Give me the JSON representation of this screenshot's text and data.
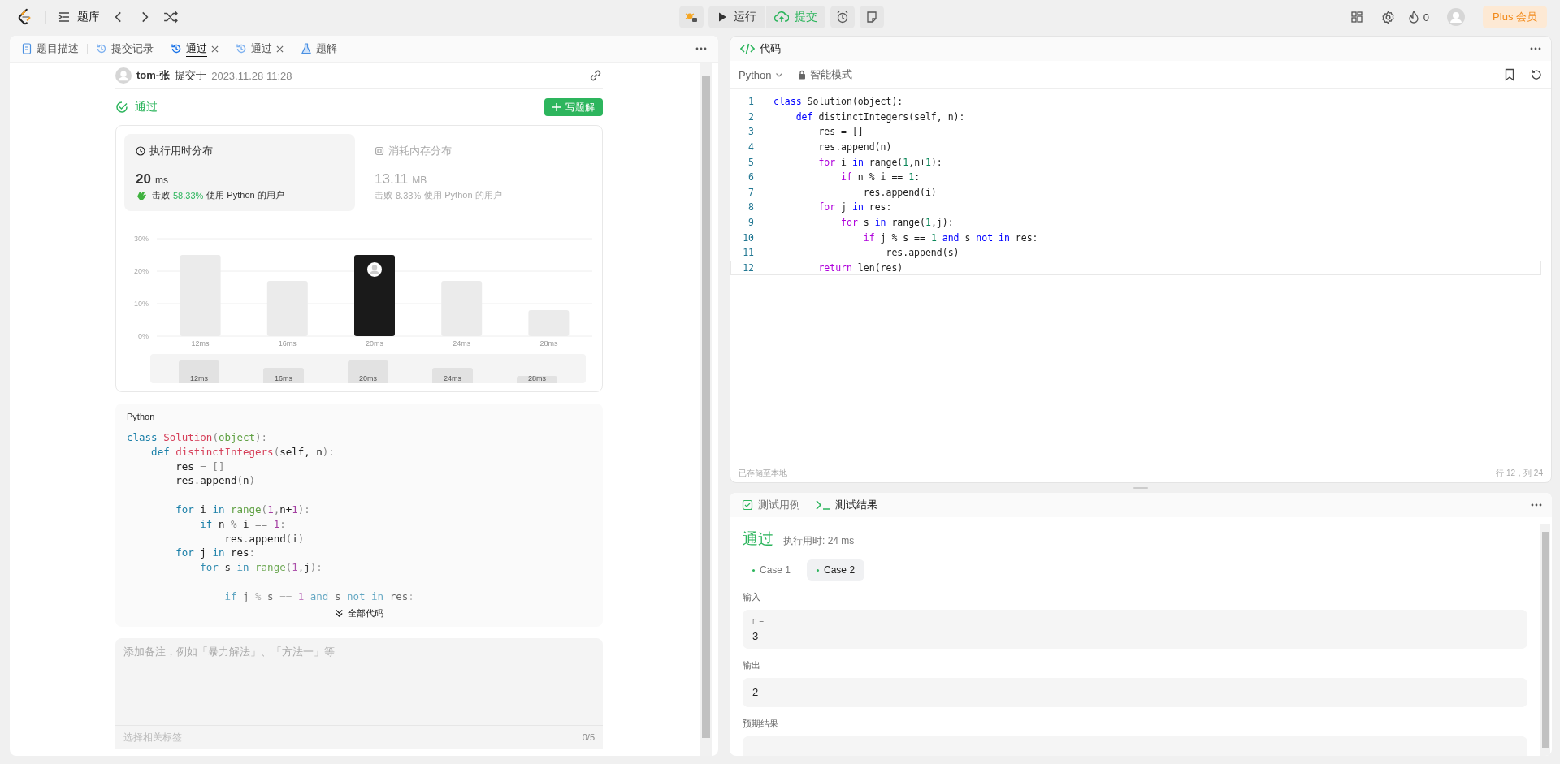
{
  "topbar": {
    "problem_list": "题库",
    "run": "运行",
    "submit": "提交",
    "streak": "0",
    "plus": "Plus 会员"
  },
  "left_tabs": [
    {
      "label": "题目描述",
      "kind": "doc",
      "selected": false,
      "closable": false
    },
    {
      "label": "提交记录",
      "kind": "history",
      "selected": false,
      "closable": false
    },
    {
      "label": "通过",
      "kind": "history",
      "selected": true,
      "closable": true
    },
    {
      "label": "通过",
      "kind": "history",
      "selected": false,
      "closable": true
    },
    {
      "label": "题解",
      "kind": "flask",
      "selected": false,
      "closable": false
    }
  ],
  "submission": {
    "user": "tom-张",
    "submitted": "提交于",
    "time": "2023.11.28 11:28",
    "status": "通过",
    "write_solution": "写题解"
  },
  "stats": {
    "tiles": [
      {
        "kind": "time",
        "title": "执行用时分布",
        "value": "20",
        "unit": "ms",
        "beat": "击败",
        "percent": "58.33%",
        "suffix": "使用 Python 的用户",
        "selected": true
      },
      {
        "kind": "memory",
        "title": "消耗内存分布",
        "value": "13.11",
        "unit": "MB",
        "beat": "击败",
        "percent": "8.33%",
        "suffix": "使用 Python 的用户",
        "selected": false
      }
    ],
    "chart_data": {
      "type": "bar",
      "categories": [
        "12ms",
        "16ms",
        "20ms",
        "24ms",
        "28ms"
      ],
      "values": [
        25,
        17,
        25,
        17,
        8
      ],
      "ylim": [
        0,
        30
      ],
      "yticks": [
        {
          "value": 0,
          "label": "0%"
        },
        {
          "value": 10,
          "label": "10%"
        },
        {
          "value": 20,
          "label": "20%"
        },
        {
          "value": 30,
          "label": "30%"
        }
      ]
    },
    "bars": [
      {
        "selected": false
      },
      {
        "selected": false
      },
      {
        "selected": true
      },
      {
        "selected": false
      },
      {
        "selected": false
      }
    ],
    "overview_labels": [
      "12ms",
      "16ms",
      "20ms",
      "24ms",
      "28ms"
    ]
  },
  "solution_code": {
    "language": "Python",
    "expand": "全部代码",
    "lines": [
      {
        "kind": "code",
        "tokens": [
          {
            "kind": "kw",
            "text": "class"
          },
          {
            "kind": "name",
            "text": " Solution"
          },
          {
            "kind": "pu",
            "text": "("
          },
          {
            "kind": "bi",
            "text": "object"
          },
          {
            "kind": "pu",
            "text": "):"
          }
        ]
      },
      {
        "kind": "code",
        "tokens": [
          {
            "kind": "kw",
            "text": "    def"
          },
          {
            "kind": "name",
            "text": " distinctIntegers"
          },
          {
            "kind": "pu",
            "text": "("
          },
          {
            "kind": "p",
            "text": "self, n"
          },
          {
            "kind": "pu",
            "text": "):"
          }
        ]
      },
      {
        "kind": "code",
        "tokens": [
          {
            "kind": "p",
            "text": "        res "
          },
          {
            "kind": "pu",
            "text": "= []"
          }
        ]
      },
      {
        "kind": "code",
        "tokens": [
          {
            "kind": "p",
            "text": "        res"
          },
          {
            "kind": "pu",
            "text": "."
          },
          {
            "kind": "p",
            "text": "append"
          },
          {
            "kind": "pu",
            "text": "("
          },
          {
            "kind": "p",
            "text": "n"
          },
          {
            "kind": "pu",
            "text": ")"
          }
        ]
      },
      {
        "kind": "blank"
      },
      {
        "kind": "code",
        "tokens": [
          {
            "kind": "ctrl",
            "text": "        for"
          },
          {
            "kind": "p",
            "text": " i "
          },
          {
            "kind": "ctrl",
            "text": "in"
          },
          {
            "kind": "bi",
            "text": " range"
          },
          {
            "kind": "pu",
            "text": "("
          },
          {
            "kind": "num",
            "text": "1"
          },
          {
            "kind": "pu",
            "text": ","
          },
          {
            "kind": "p",
            "text": "n+"
          },
          {
            "kind": "num",
            "text": "1"
          },
          {
            "kind": "pu",
            "text": "):"
          }
        ]
      },
      {
        "kind": "code",
        "tokens": [
          {
            "kind": "ctrl",
            "text": "            if"
          },
          {
            "kind": "p",
            "text": " n "
          },
          {
            "kind": "pu",
            "text": "%"
          },
          {
            "kind": "p",
            "text": " i "
          },
          {
            "kind": "pu",
            "text": "=="
          },
          {
            "kind": "num",
            "text": " 1"
          },
          {
            "kind": "pu",
            "text": ":"
          }
        ]
      },
      {
        "kind": "code",
        "tokens": [
          {
            "kind": "p",
            "text": "                res"
          },
          {
            "kind": "pu",
            "text": "."
          },
          {
            "kind": "p",
            "text": "append"
          },
          {
            "kind": "pu",
            "text": "("
          },
          {
            "kind": "p",
            "text": "i"
          },
          {
            "kind": "pu",
            "text": ")"
          }
        ]
      },
      {
        "kind": "code",
        "tokens": [
          {
            "kind": "ctrl",
            "text": "        for"
          },
          {
            "kind": "p",
            "text": " j "
          },
          {
            "kind": "ctrl",
            "text": "in"
          },
          {
            "kind": "p",
            "text": " res"
          },
          {
            "kind": "pu",
            "text": ":"
          }
        ]
      },
      {
        "kind": "code",
        "tokens": [
          {
            "kind": "ctrl",
            "text": "            for"
          },
          {
            "kind": "p",
            "text": " s "
          },
          {
            "kind": "ctrl",
            "text": "in"
          },
          {
            "kind": "bi",
            "text": " range"
          },
          {
            "kind": "pu",
            "text": "("
          },
          {
            "kind": "num",
            "text": "1"
          },
          {
            "kind": "pu",
            "text": ","
          },
          {
            "kind": "p",
            "text": "j"
          },
          {
            "kind": "pu",
            "text": "):"
          }
        ]
      },
      {
        "kind": "blank"
      },
      {
        "kind": "code",
        "tokens": [
          {
            "kind": "ctrl",
            "text": "                if"
          },
          {
            "kind": "p",
            "text": " j "
          },
          {
            "kind": "pu",
            "text": "%"
          },
          {
            "kind": "p",
            "text": " s "
          },
          {
            "kind": "pu",
            "text": "=="
          },
          {
            "kind": "num",
            "text": " 1"
          },
          {
            "kind": "ctrl",
            "text": " and"
          },
          {
            "kind": "p",
            "text": " s "
          },
          {
            "kind": "ctrl",
            "text": "not"
          },
          {
            "kind": "ctrl",
            "text": " in"
          },
          {
            "kind": "p",
            "text": " res"
          },
          {
            "kind": "pu",
            "text": ":"
          }
        ]
      }
    ]
  },
  "note": {
    "placeholder": "添加备注，例如「暴力解法」、「方法一」等",
    "tags": "选择相关标签",
    "count": "0/5"
  },
  "editor": {
    "title": "代码",
    "language": "Python",
    "mode": "智能模式",
    "saved": "已存储至本地",
    "cursor": "行 12，列 24",
    "lines": [
      {
        "number": "1",
        "current": false,
        "tokens": [
          {
            "kind": "kw",
            "text": "class"
          },
          {
            "kind": "p",
            "text": " Solution(object):"
          }
        ]
      },
      {
        "number": "2",
        "current": false,
        "tokens": [
          {
            "kind": "kw",
            "text": "    def"
          },
          {
            "kind": "p",
            "text": " distinctIntegers(self, n):"
          }
        ]
      },
      {
        "number": "3",
        "current": false,
        "tokens": [
          {
            "kind": "p",
            "text": "        res = []"
          }
        ]
      },
      {
        "number": "4",
        "current": false,
        "tokens": [
          {
            "kind": "p",
            "text": "        res.append(n)"
          }
        ]
      },
      {
        "number": "5",
        "current": false,
        "tokens": [
          {
            "kind": "ctrl",
            "text": "        for"
          },
          {
            "kind": "p",
            "text": " i "
          },
          {
            "kind": "kw",
            "text": "in"
          },
          {
            "kind": "p",
            "text": " range("
          },
          {
            "kind": "num",
            "text": "1"
          },
          {
            "kind": "p",
            "text": ",n+"
          },
          {
            "kind": "num",
            "text": "1"
          },
          {
            "kind": "p",
            "text": "):"
          }
        ]
      },
      {
        "number": "6",
        "current": false,
        "tokens": [
          {
            "kind": "ctrl",
            "text": "            if"
          },
          {
            "kind": "p",
            "text": " n % i == "
          },
          {
            "kind": "num",
            "text": "1"
          },
          {
            "kind": "p",
            "text": ":"
          }
        ]
      },
      {
        "number": "7",
        "current": false,
        "tokens": [
          {
            "kind": "p",
            "text": "                res.append(i)"
          }
        ]
      },
      {
        "number": "8",
        "current": false,
        "tokens": [
          {
            "kind": "ctrl",
            "text": "        for"
          },
          {
            "kind": "p",
            "text": " j "
          },
          {
            "kind": "kw",
            "text": "in"
          },
          {
            "kind": "p",
            "text": " res:"
          }
        ]
      },
      {
        "number": "9",
        "current": false,
        "tokens": [
          {
            "kind": "ctrl",
            "text": "            for"
          },
          {
            "kind": "p",
            "text": " s "
          },
          {
            "kind": "kw",
            "text": "in"
          },
          {
            "kind": "p",
            "text": " range("
          },
          {
            "kind": "num",
            "text": "1"
          },
          {
            "kind": "p",
            "text": ",j):"
          }
        ]
      },
      {
        "number": "10",
        "current": false,
        "tokens": [
          {
            "kind": "ctrl",
            "text": "                if"
          },
          {
            "kind": "p",
            "text": " j % s == "
          },
          {
            "kind": "num",
            "text": "1"
          },
          {
            "kind": "kw",
            "text": " and"
          },
          {
            "kind": "p",
            "text": " s "
          },
          {
            "kind": "kw",
            "text": "not"
          },
          {
            "kind": "kw",
            "text": " in"
          },
          {
            "kind": "p",
            "text": " res:"
          }
        ]
      },
      {
        "number": "11",
        "current": false,
        "tokens": [
          {
            "kind": "p",
            "text": "                    res.append(s)"
          }
        ]
      },
      {
        "number": "12",
        "current": true,
        "tokens": [
          {
            "kind": "ctrl",
            "text": "        return"
          },
          {
            "kind": "p",
            "text": " len(res)"
          }
        ]
      }
    ]
  },
  "console": {
    "tabs": [
      {
        "label": "测试用例",
        "kind": "cases",
        "selected": false
      },
      {
        "label": "测试结果",
        "kind": "result",
        "selected": true
      }
    ],
    "status": "通过",
    "runtime": "执行用时: 24 ms",
    "cases": [
      {
        "label": "Case 1",
        "selected": false,
        "passed": true
      },
      {
        "label": "Case 2",
        "selected": true,
        "passed": true
      }
    ],
    "sections": [
      {
        "label": "输入",
        "var": "n =",
        "value": "3"
      },
      {
        "label": "输出",
        "value": "2"
      },
      {
        "label": "预期结果"
      }
    ]
  }
}
